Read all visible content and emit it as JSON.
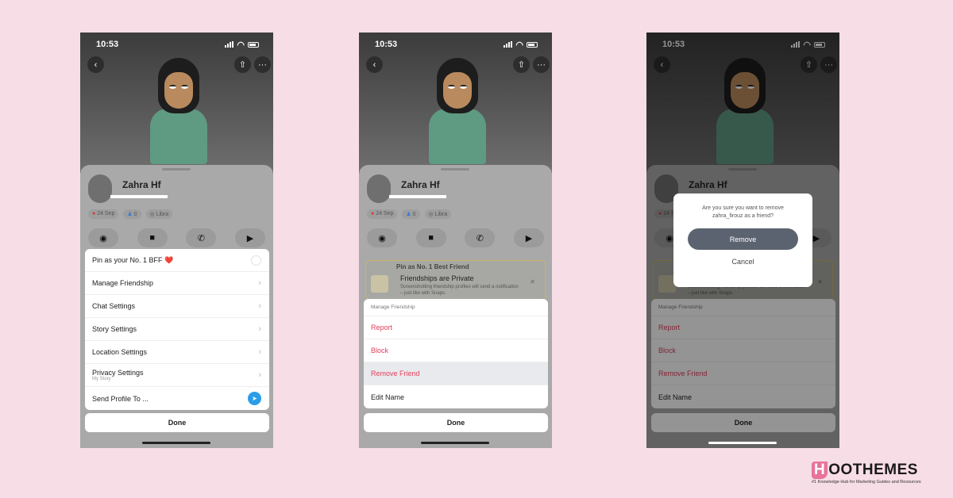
{
  "status_bar": {
    "time": "10:53"
  },
  "profile": {
    "name": "Zahra Hf",
    "birthday": "24 Sep",
    "friends_count": "0",
    "zodiac": "Libra"
  },
  "screen1": {
    "menu": [
      {
        "label": "Pin as your No. 1 BFF ❤️",
        "control": "radio"
      },
      {
        "label": "Manage Friendship",
        "control": "chevron"
      },
      {
        "label": "Chat Settings",
        "control": "chevron"
      },
      {
        "label": "Story Settings",
        "control": "chevron"
      },
      {
        "label": "Location Settings",
        "control": "chevron"
      },
      {
        "label": "Privacy Settings",
        "sublabel": "My Story",
        "control": "chevron"
      },
      {
        "label": "Send Profile To ...",
        "control": "send"
      }
    ],
    "done_label": "Done"
  },
  "screen2": {
    "card_title_partial": "Pin as No. 1 Best Friend",
    "card_title": "Friendships are Private",
    "card_text": "Screenshotting friendship profiles will send a notification – just like with Snaps.",
    "menu_header": "Manage Friendship",
    "menu": [
      {
        "label": "Report",
        "style": "destructive"
      },
      {
        "label": "Block",
        "style": "destructive"
      },
      {
        "label": "Remove Friend",
        "style": "destructive",
        "highlighted": true
      },
      {
        "label": "Edit Name",
        "style": "normal"
      }
    ],
    "done_label": "Done"
  },
  "screen3": {
    "dialog_question": "Are you sure you want to remove zahra_firouz as a friend?",
    "dialog_confirm": "Remove",
    "dialog_cancel": "Cancel",
    "menu_header": "Manage Friendship",
    "menu": [
      {
        "label": "Report"
      },
      {
        "label": "Block"
      },
      {
        "label": "Remove Friend"
      },
      {
        "label": "Edit Name"
      }
    ],
    "done_label": "Done"
  },
  "brand": {
    "name": "HOOTHEMES",
    "tagline": "#1 Knowledge Hub for Marketing Guides and Resources",
    "accent": "#e8739a"
  },
  "colors": {
    "background": "#f7dde5",
    "destructive": "#e0405e",
    "send_button": "#2b9de8",
    "dialog_button": "#5c6370"
  }
}
